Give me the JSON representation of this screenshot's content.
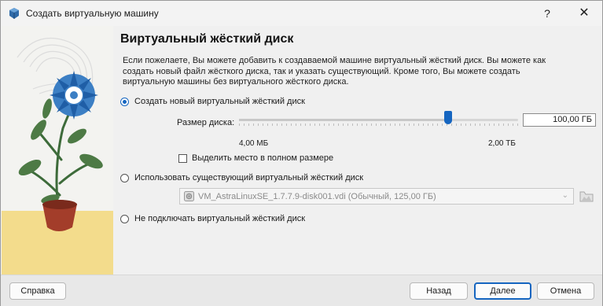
{
  "window": {
    "title": "Создать виртуальную машину",
    "help_glyph": "?",
    "close_glyph": "✕"
  },
  "page": {
    "heading": "Виртуальный жёсткий диск",
    "description": "Если пожелаете, Вы можете добавить к создаваемой машине виртуальный жёсткий диск. Вы можете как создать новый файл жёсткого диска, так и указать существующий. Кроме того, Вы можете создать виртуальную машины без виртуального жёсткого диска."
  },
  "options": {
    "create_new": {
      "label": "Создать новый виртуальный жёсткий диск",
      "checked": true,
      "size_label": "Размер диска:",
      "size_value": "100,00 ГБ",
      "slider_min_label": "4,00 МБ",
      "slider_max_label": "2,00 ТБ",
      "slider_position": 0.75,
      "preallocate_label": "Выделить место в полном размере",
      "preallocate_checked": false
    },
    "use_existing": {
      "label": "Использовать существующий виртуальный жёсткий диск",
      "checked": false,
      "selected_disk": "VM_AstraLinuxSE_1.7.7.9-disk001.vdi (Обычный, 125,00 ГБ)"
    },
    "no_disk": {
      "label": "Не подключать виртуальный жёсткий диск",
      "checked": false
    }
  },
  "footer": {
    "help_label": "Справка",
    "back_label": "Назад",
    "next_label": "Далее",
    "cancel_label": "Отмена"
  },
  "colors": {
    "accent": "#1565c0",
    "art_background": "#f3f3f0",
    "art_floor": "#f3dc8c"
  }
}
